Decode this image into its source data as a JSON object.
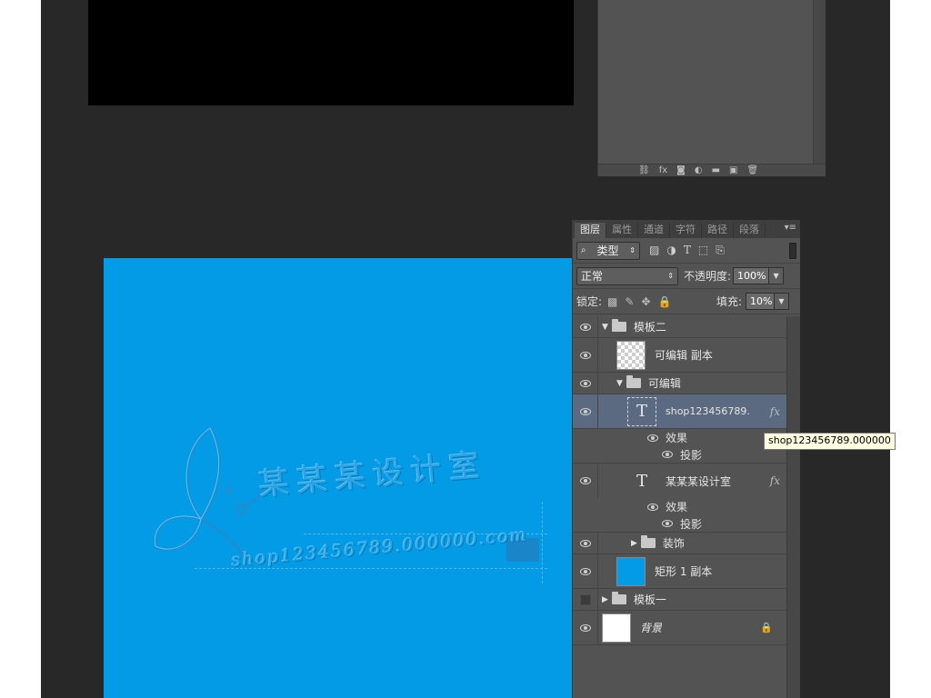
{
  "canvas": {
    "brand_title": "某某某设计室",
    "brand_url": "shop123456789.000000.com"
  },
  "top_panel": {
    "footer_icons": [
      "link-icon",
      "fx-icon",
      "mask-icon",
      "adjustment-icon",
      "folder-icon",
      "new-layer-icon",
      "trash-icon"
    ]
  },
  "layers_panel": {
    "tabs": [
      "图层",
      "属性",
      "通道",
      "字符",
      "路径",
      "段落"
    ],
    "active_tab": "图层",
    "menu_glyph": "▾≡",
    "filter": {
      "kind_label": "类型"
    },
    "blend_mode": "正常",
    "opacity_label": "不透明度:",
    "opacity_value": "100%",
    "lock_label": "锁定:",
    "fill_label": "填充:",
    "fill_value": "10%",
    "layers": [
      {
        "name": "模板二",
        "type": "group",
        "expanded": true,
        "visible": true
      },
      {
        "name": "可编辑 副本",
        "type": "layer",
        "visible": true
      },
      {
        "name": "可编辑",
        "type": "group",
        "expanded": true,
        "visible": true
      },
      {
        "name": "shop123456789....",
        "type": "text",
        "visible": true,
        "selected": true,
        "fx": "fx",
        "effects_label": "效果",
        "effects": [
          "投影"
        ]
      },
      {
        "name": "某某某设计室",
        "type": "text",
        "visible": true,
        "fx": "fx",
        "effects_label": "效果",
        "effects": [
          "投影"
        ]
      },
      {
        "name": "装饰",
        "type": "group",
        "expanded": false,
        "visible": true
      },
      {
        "name": "矩形 1 副本",
        "type": "shape",
        "visible": true
      },
      {
        "name": "模板一",
        "type": "group",
        "expanded": false,
        "visible": false
      },
      {
        "name": "背景",
        "type": "background",
        "visible": true,
        "locked": true
      }
    ]
  },
  "tooltip": "shop123456789.000000",
  "colors": {
    "canvas_blue": "#039be5",
    "workspace": "#282828",
    "panel": "#535353",
    "selected_row": "#5b6a80"
  }
}
